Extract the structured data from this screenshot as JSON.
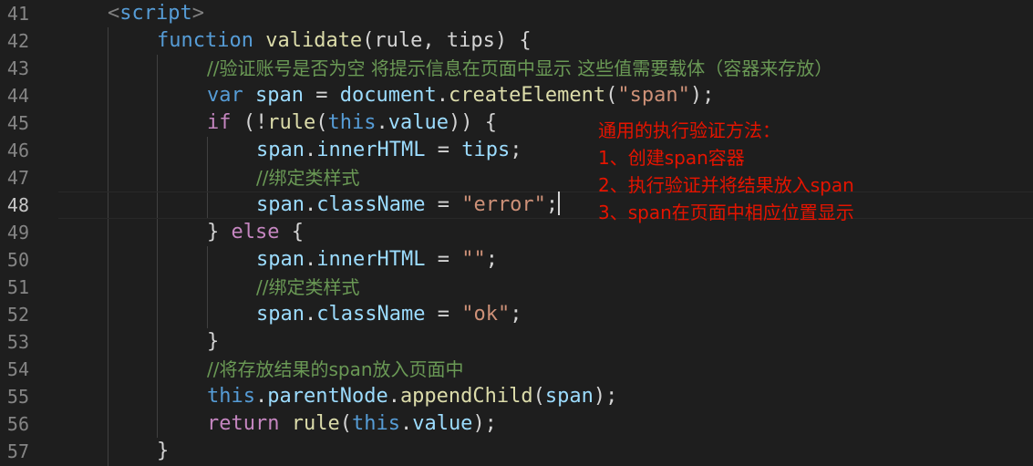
{
  "editor": {
    "current_line": "48",
    "lines": [
      {
        "num": "41"
      },
      {
        "num": "42"
      },
      {
        "num": "43"
      },
      {
        "num": "44"
      },
      {
        "num": "45"
      },
      {
        "num": "46"
      },
      {
        "num": "47"
      },
      {
        "num": "48"
      },
      {
        "num": "49"
      },
      {
        "num": "50"
      },
      {
        "num": "51"
      },
      {
        "num": "52"
      },
      {
        "num": "53"
      },
      {
        "num": "54"
      },
      {
        "num": "55"
      },
      {
        "num": "56"
      },
      {
        "num": "57"
      }
    ],
    "code": {
      "l41": {
        "open": "<",
        "tag": "script",
        "close": ">"
      },
      "l42": {
        "kw": "function",
        "name": "validate",
        "params": "(rule, tips) {"
      },
      "l43": {
        "comment": "//验证账号是否为空 将提示信息在页面中显示 这些值需要载体（容器来存放）"
      },
      "l44": {
        "kw": "var",
        "var": "span",
        "eq": " = ",
        "obj": "document",
        "dot": ".",
        "fn": "createElement",
        "p1": "(",
        "str": "\"span\"",
        "p2": ");"
      },
      "l45": {
        "kw": "if",
        "p1": " (!",
        "fn": "rule",
        "p2": "(",
        "this": "this",
        "dot": ".",
        "prop": "value",
        "p3": ")) {"
      },
      "l46": {
        "obj": "span",
        "dot": ".",
        "prop": "innerHTML",
        "eq": " = ",
        "val": "tips",
        "end": ";"
      },
      "l47": {
        "comment": "//绑定类样式"
      },
      "l48": {
        "obj": "span",
        "dot": ".",
        "prop": "className",
        "eq": " = ",
        "str": "\"error\"",
        "end": ";"
      },
      "l49": {
        "p1": "} ",
        "kw": "else",
        "p2": " {"
      },
      "l50": {
        "obj": "span",
        "dot": ".",
        "prop": "innerHTML",
        "eq": " = ",
        "str": "\"\"",
        "end": ";"
      },
      "l51": {
        "comment": "//绑定类样式"
      },
      "l52": {
        "obj": "span",
        "dot": ".",
        "prop": "className",
        "eq": " = ",
        "str": "\"ok\"",
        "end": ";"
      },
      "l53": {
        "brace": "}"
      },
      "l54": {
        "comment": "//将存放结果的span放入页面中"
      },
      "l55": {
        "this": "this",
        "dot": ".",
        "prop": "parentNode",
        "dot2": ".",
        "fn": "appendChild",
        "p1": "(",
        "arg": "span",
        "p2": ");"
      },
      "l56": {
        "kw": "return",
        "sp": " ",
        "fn": "rule",
        "p1": "(",
        "this": "this",
        "dot": ".",
        "prop": "value",
        "p2": ");"
      },
      "l57": {
        "brace": "}"
      }
    }
  },
  "annotation": {
    "title": "通用的执行验证方法：",
    "step1": "1、创建span容器",
    "step2": "2、执行验证并将结果放入span",
    "step3": "3、span在页面中相应位置显示"
  },
  "colors": {
    "background": "#1e1e1e",
    "keyword": "#569cd6",
    "control": "#c586c0",
    "function": "#dcdcaa",
    "variable": "#9cdcfe",
    "string": "#ce9178",
    "comment": "#6a9955",
    "annotation": "#e51400"
  }
}
